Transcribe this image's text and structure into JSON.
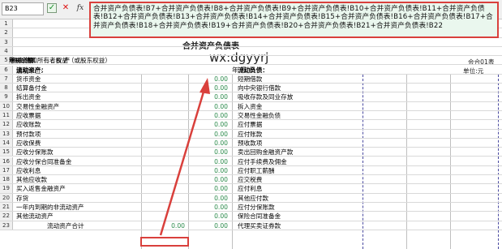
{
  "name_box": "B23",
  "formula_bar": {
    "check_icon": "checkmark-icon",
    "cancel_icon": "cancel-x-icon",
    "fx_label": "fx",
    "formula": "合并资产负债表!B7+合并资产负债表!B8+合并资产负债表!B9+合并资产负债表!B10+合并资产负债表!B11+合并资产负债表!B12+合并资产负债表!B13+合并资产负债表!B14+合并资产负债表!B15+合并资产负债表!B16+合并资产负债表!B17+合并资产负债表!B18+合并资产负债表!B19+合并资产负债表!B20+合并资产负债表!B21+合并资产负债表!B22"
  },
  "sheet": {
    "title_fragment": "合并资产负债表",
    "watermark": "wx:dgyyrj",
    "period": "年 月 日",
    "form_no": "会合01表",
    "unit_right": "单位:元",
    "unit_left": "编制单位:",
    "headers": [
      "资 产",
      "期末余额",
      "年初余额",
      "负债和所有者权益（或股东权益）",
      "期末余额",
      "年初余额"
    ],
    "rows": [
      {
        "n": "1",
        "a": "",
        "b": "",
        "c": "",
        "d": ""
      },
      {
        "n": "2",
        "a": "",
        "b": "",
        "c": "",
        "d": ""
      },
      {
        "n": "3",
        "a": "",
        "b": "",
        "c": "",
        "d": ""
      },
      {
        "n": "4",
        "a": "",
        "b": "",
        "c": "",
        "d": ""
      },
      {
        "n": "5",
        "a": "",
        "b": "",
        "c": "",
        "d": ""
      },
      {
        "n": "6",
        "a": "流动资产：",
        "b": "",
        "c": "",
        "d": "流动负债："
      },
      {
        "n": "7",
        "a": "货币资金",
        "b": "",
        "c": "0.00",
        "d": "短期借款"
      },
      {
        "n": "8",
        "a": "结算备付金",
        "b": "",
        "c": "0.00",
        "d": "向中央银行借款"
      },
      {
        "n": "9",
        "a": "拆出资金",
        "b": "",
        "c": "0.00",
        "d": "吸收存款及同业存放"
      },
      {
        "n": "10",
        "a": "交易性金融资产",
        "b": "",
        "c": "0.00",
        "d": "拆入资金"
      },
      {
        "n": "11",
        "a": "应收票据",
        "b": "",
        "c": "0.00",
        "d": "交易性金融负债"
      },
      {
        "n": "12",
        "a": "应收账款",
        "b": "",
        "c": "0.00",
        "d": "应付票据"
      },
      {
        "n": "13",
        "a": "预付款项",
        "b": "",
        "c": "0.00",
        "d": "应付账款"
      },
      {
        "n": "14",
        "a": "应收保费",
        "b": "",
        "c": "0.00",
        "d": "预收款项"
      },
      {
        "n": "15",
        "a": "应收分保账款",
        "b": "",
        "c": "0.00",
        "d": "卖出回购金融资产款"
      },
      {
        "n": "16",
        "a": "应收分保合同准备金",
        "b": "",
        "c": "0.00",
        "d": "应付手续费及佣金"
      },
      {
        "n": "17",
        "a": "应收利息",
        "b": "",
        "c": "0.00",
        "d": "应付职工薪酬"
      },
      {
        "n": "18",
        "a": "其他应收款",
        "b": "",
        "c": "0.00",
        "d": "应交税费"
      },
      {
        "n": "19",
        "a": "买入返售金融资产",
        "b": "",
        "c": "0.00",
        "d": "应付利息"
      },
      {
        "n": "20",
        "a": "存货",
        "b": "",
        "c": "0.00",
        "d": "其他应付款"
      },
      {
        "n": "21",
        "a": "一年内到期的非流动资产",
        "b": "",
        "c": "0.00",
        "d": "应付分保账款"
      },
      {
        "n": "22",
        "a": "其他流动资产",
        "b": "",
        "c": "0.00",
        "d": "保险合同准备金"
      },
      {
        "n": "23",
        "a": "流动资产合计",
        "b": "0.00",
        "c": "0.00",
        "d": "代理买卖证券款"
      }
    ]
  },
  "colors": {
    "highlight": "#d9403c",
    "value_text": "#2a8a4a",
    "popup_bg": "#eaf7ee"
  }
}
